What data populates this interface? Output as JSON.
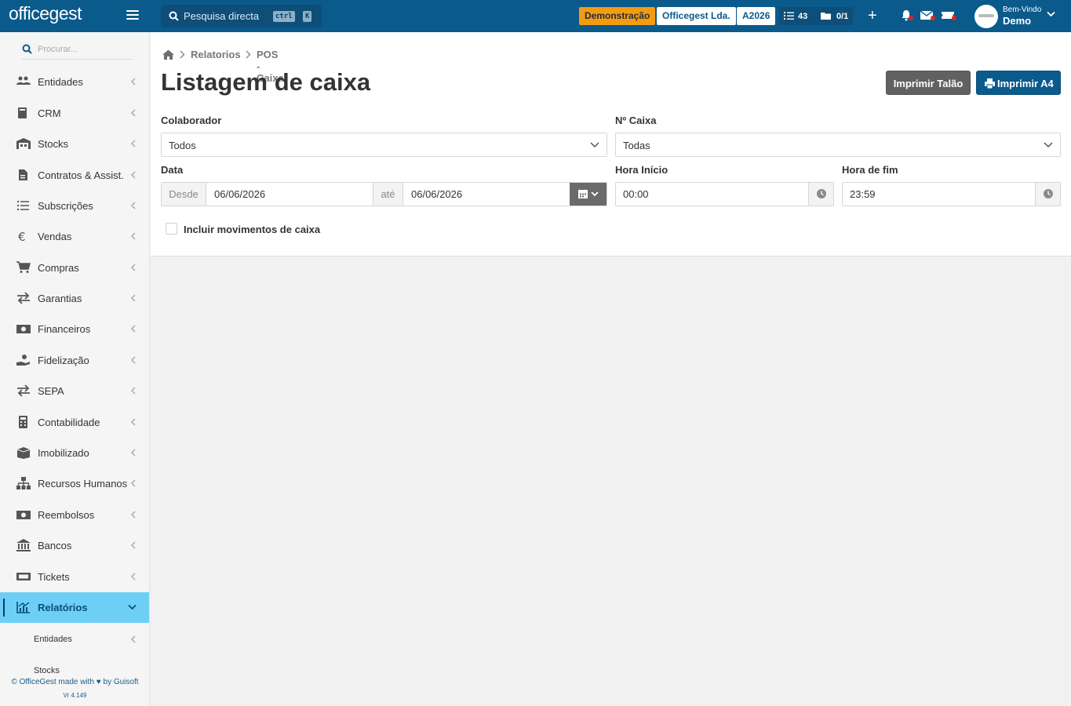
{
  "header": {
    "logo": "officegest",
    "search_placeholder": "Pesquisa directa",
    "kbd_ctrl": "ctrl",
    "kbd_k": "K",
    "demo_badge": "Demonstração",
    "company": "Officegest Lda.",
    "year": "A2026",
    "tasks_count": "43",
    "docs_count": "0/1",
    "welcome": "Bem-Vindo",
    "user": "Demo",
    "colors": {
      "bar": "#0a5a8c",
      "demo_badge": "#f39c12",
      "notification_dot": "#e02424"
    }
  },
  "sidebar": {
    "search_placeholder": "Procurar...",
    "items": [
      {
        "label": "Entidades",
        "icon": "users-icon"
      },
      {
        "label": "CRM",
        "icon": "book-icon"
      },
      {
        "label": "Stocks",
        "icon": "warehouse-icon"
      },
      {
        "label": "Contratos & Assist.",
        "icon": "contract-icon"
      },
      {
        "label": "Subscrições",
        "icon": "list-icon"
      },
      {
        "label": "Vendas",
        "icon": "euro-icon"
      },
      {
        "label": "Compras",
        "icon": "cart-icon"
      },
      {
        "label": "Garantias",
        "icon": "exchange-icon"
      },
      {
        "label": "Financeiros",
        "icon": "money-icon"
      },
      {
        "label": "Fidelização",
        "icon": "hand-coin-icon"
      },
      {
        "label": "SEPA",
        "icon": "exchange-icon"
      },
      {
        "label": "Contabilidade",
        "icon": "calculator-icon"
      },
      {
        "label": "Imobilizado",
        "icon": "box-icon"
      },
      {
        "label": "Recursos Humanos",
        "icon": "sitemap-icon"
      },
      {
        "label": "Reembolsos",
        "icon": "money-icon"
      },
      {
        "label": "Bancos",
        "icon": "bank-icon"
      },
      {
        "label": "Tickets",
        "icon": "ticket-icon"
      },
      {
        "label": "Relatórios",
        "icon": "chart-icon",
        "active": true
      }
    ],
    "sub_items": [
      {
        "label": "Entidades"
      },
      {
        "label": "Stocks"
      }
    ],
    "footer_credits": "© OfficeGest made with ♥ by Guisoft",
    "version": "Vr 4.149",
    "active_color": "#6dcff6"
  },
  "breadcrumb": {
    "items": [
      "Relatorios",
      "POS - Caixa"
    ]
  },
  "page": {
    "title": "Listagem de caixa",
    "btn_talao": "Imprimir Talão",
    "btn_a4": "Imprimir A4"
  },
  "form": {
    "colaborador_label": "Colaborador",
    "colaborador_value": "Todos",
    "caixa_label": "Nº Caixa",
    "caixa_value": "Todas",
    "data_label": "Data",
    "desde_label": "Desde",
    "desde_value": "06/06/2026",
    "ate_label": "até",
    "ate_value": "06/06/2026",
    "hora_inicio_label": "Hora Início",
    "hora_inicio_value": "00:00",
    "hora_fim_label": "Hora de fim",
    "hora_fim_value": "23:59",
    "incluir_label": "Incluir movimentos de caixa",
    "incluir_checked": false
  }
}
